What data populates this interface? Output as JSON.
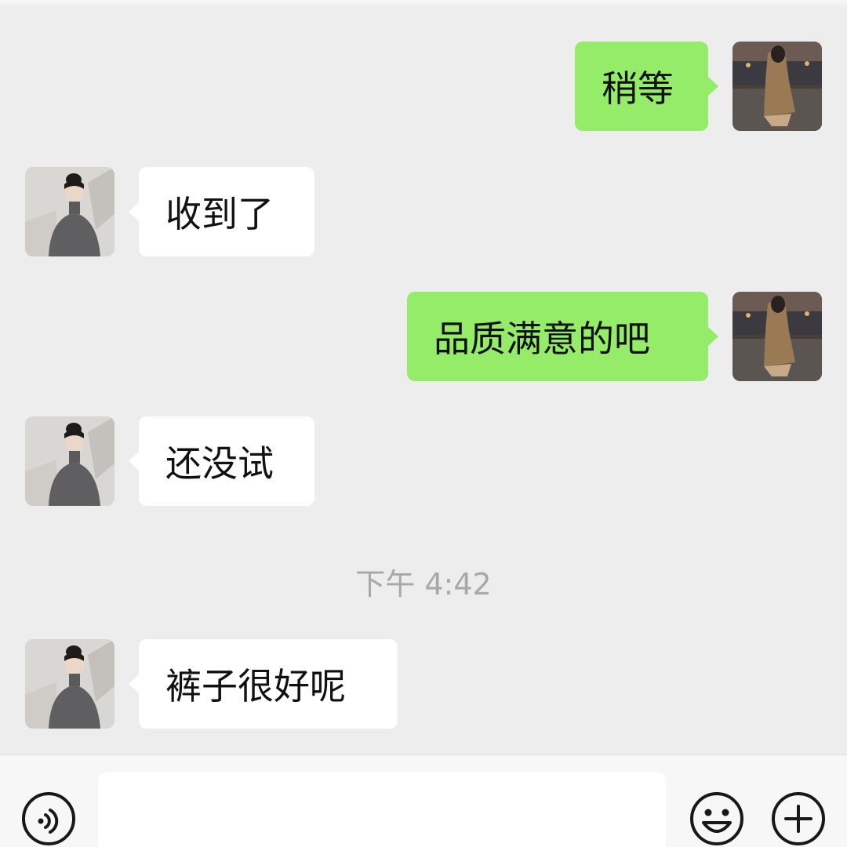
{
  "chat": {
    "messages": [
      {
        "sender": "me",
        "text": "稍等"
      },
      {
        "sender": "them",
        "text": "收到了"
      },
      {
        "sender": "me",
        "text": "品质满意的吧"
      },
      {
        "sender": "them",
        "text": "还没试"
      },
      {
        "sender": "them",
        "text": "裤子很好呢"
      }
    ],
    "timestamp": "下午 4:42"
  },
  "input_bar": {
    "text_value": "",
    "icons": [
      "voice-icon",
      "emoji-icon",
      "plus-icon"
    ]
  },
  "colors": {
    "background": "#ededed",
    "my_bubble": "#95ec69",
    "their_bubble": "#ffffff",
    "timestamp": "#a8a8a8"
  }
}
